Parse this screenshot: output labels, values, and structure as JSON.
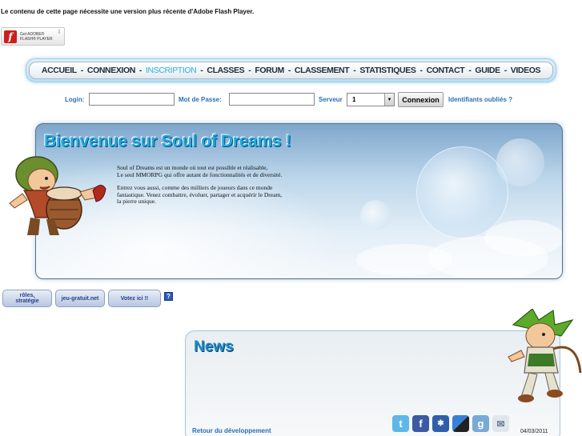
{
  "flash": {
    "notice": "Le contenu de cette page nécessite une version plus récente d'Adobe Flash Player.",
    "badge_line1": "Get ADOBE®",
    "badge_line2": "FLASH® PLAYER"
  },
  "menu": {
    "items": [
      {
        "label": "ACCUEIL"
      },
      {
        "label": "CONNEXION"
      },
      {
        "label": "INSCRIPTION",
        "active": true
      },
      {
        "label": "CLASSES"
      },
      {
        "label": "FORUM"
      },
      {
        "label": "CLASSEMENT"
      },
      {
        "label": "STATISTIQUES"
      },
      {
        "label": "CONTACT"
      },
      {
        "label": "GUIDE"
      },
      {
        "label": "VIDEOS"
      }
    ],
    "separator": "-",
    "active_color": "#33aee0"
  },
  "login": {
    "login_label": "Login:",
    "login_value": "",
    "password_label": "Mot de Passe:",
    "password_value": "",
    "server_label": "Serveur",
    "server_value": "1",
    "connect_button": "Connexion",
    "forgot_link": "Identifiants oubliés ?"
  },
  "welcome": {
    "title": "Bienvenue sur Soul of Dreams !",
    "p1_line1": "Soul of Dreams est un monde où tout est possible et réalisable,",
    "p1_line2": "Le seul MMORPG qui offre autant de fonctionnalités et de diversité.",
    "p2_line1": "Entrez vous aussi, comme des milliers de joueurs dans ce monde",
    "p2_line2": "fantastique. Venez combattre, évoluer, partager et acquérir le Dream,",
    "p2_line3": "la pierre unique."
  },
  "vote_buttons": {
    "btn1_line1": "rôles,",
    "btn1_line2": "stratégie",
    "btn2": "jeu-gratuit.net",
    "btn3": "Votez ici !!",
    "help": "?"
  },
  "news": {
    "title": "News",
    "link": "Retour du développement",
    "date": "04/03/2011",
    "share_icons": [
      "twitter-icon",
      "facebook-icon",
      "myspace-icon",
      "delicious-icon",
      "google-icon",
      "email-icon"
    ]
  },
  "colors": {
    "link_blue": "#2a70b4",
    "title_blue": "#23a9df",
    "flash_red": "#c8201c"
  }
}
